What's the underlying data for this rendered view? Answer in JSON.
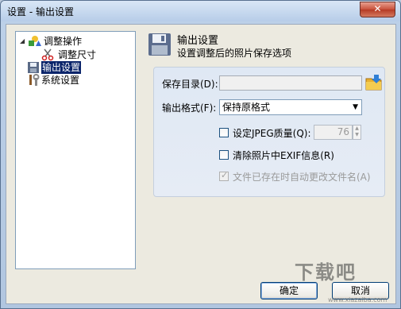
{
  "window": {
    "title": "设置 - 输出设置",
    "close_glyph": "✕"
  },
  "tree": {
    "items": [
      {
        "label": "调整操作",
        "icon": "tools-shapes-icon",
        "expander": "◢"
      },
      {
        "label": "调整尺寸",
        "icon": "scissors-icon"
      },
      {
        "label": "输出设置",
        "icon": "floppy-disk-icon"
      },
      {
        "label": "系统设置",
        "icon": "wrench-icon"
      }
    ]
  },
  "header": {
    "title": "输出设置",
    "subtitle": "设置调整后的照片保存选项",
    "icon": "floppy-disk-icon"
  },
  "form": {
    "save_dir_label": "保存目录(D):",
    "save_dir_value": "",
    "browse_icon": "folder-arrow-icon",
    "format_label": "输出格式(F):",
    "format_value": "保持原格式",
    "jpeg_quality_label": "设定JPEG质量(Q):",
    "jpeg_quality_checked": false,
    "jpeg_quality_value": "76",
    "remove_exif_label": "清除照片中EXIF信息(R)",
    "remove_exif_checked": false,
    "auto_rename_label": "文件已存在时自动更改文件名(A)",
    "auto_rename_checked": true
  },
  "buttons": {
    "ok": "确定",
    "cancel": "取消"
  },
  "watermark": {
    "text": "下载吧",
    "url": "www.xiazaiba.com"
  }
}
